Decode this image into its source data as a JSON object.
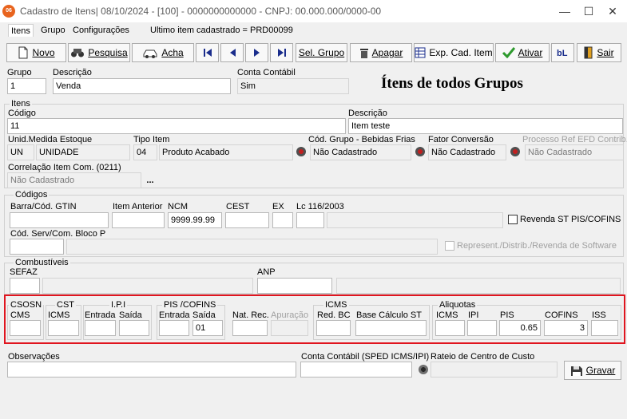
{
  "window": {
    "title": "Cadastro de Itens|  08/10/2024 - [100] - 0000000000000 - CNPJ: 00.000.000/0000-00",
    "app_icon_text": "06",
    "minimize": "—",
    "maximize": "☐",
    "close": "✕"
  },
  "menu": {
    "items": [
      "Itens",
      "Grupo",
      "Configurações"
    ],
    "last_item_info": "Ultimo item cadastrado = PRD00099"
  },
  "toolbar": {
    "novo": "Novo",
    "pesquisa": "Pesquisa",
    "acha": "Acha",
    "sel_grupo": "Sel. Grupo",
    "apagar": "Apagar",
    "exp_cad": "Exp. Cad. Item",
    "ativar": "Ativar",
    "sair": "Sair"
  },
  "header": {
    "grupo_label": "Grupo",
    "grupo_value": "1",
    "descricao_label": "Descrição",
    "descricao_value": "Venda",
    "conta_contabil_label": "Conta Contábil",
    "conta_contabil_value": "Sim",
    "big_title": "Ítens de todos Grupos"
  },
  "itens": {
    "group_title": "Itens",
    "codigo_label": "Código",
    "codigo_value": "11",
    "descricao_label": "Descrição",
    "descricao_value": "Item teste",
    "unid_label": "Unid.Medida Estoque",
    "unid_code": "UN",
    "unid_desc": "UNIDADE",
    "tipo_label": "Tipo Item",
    "tipo_code": "04",
    "tipo_desc": "Produto Acabado",
    "cod_grupo_label": "Cód. Grupo - Bebidas Frias",
    "cod_grupo_value": "Não Cadastrado",
    "fator_label": "Fator Conversão",
    "fator_value": "Não Cadastrado",
    "processo_label": "Processo Ref EFD Contrib.",
    "processo_value": "Não Cadastrado",
    "correlacao_label": "Correlação Item Com. (0211)",
    "correlacao_value": "Não Cadastrado",
    "correlacao_btn": "..."
  },
  "codigos": {
    "group_title": "Códigos",
    "barra_label": "Barra/Cód. GTIN",
    "barra_value": "",
    "anterior_label": "Item Anterior",
    "anterior_value": "",
    "ncm_label": "NCM",
    "ncm_value": "9999.99.99",
    "cest_label": "CEST",
    "cest_value": "",
    "ex_label": "EX",
    "ex_value": "",
    "lc_label": "Lc 116/2003",
    "lc_value": "",
    "revenda_label": "Revenda ST PIS/COFINS",
    "serv_label": "Cód. Serv/Com. Bloco P",
    "serv_value": "",
    "represent_label": "Represent./Distrib./Revenda de Software"
  },
  "combustiveis": {
    "group_title": "Combustíveis",
    "sefaz_label": "SEFAZ",
    "sefaz_value": "",
    "anp_label": "ANP",
    "anp_value": ""
  },
  "tributos": {
    "csosn_label": "CSOSN",
    "cms_label": "CMS",
    "cst_label": "CST",
    "cst_icms_label": "ICMS",
    "ipi_label": "I.P.I",
    "ipi_entrada_label": "Entrada",
    "ipi_saida_label": "Saída",
    "pis_cofins_label": "PIS /COFINS",
    "pc_entrada_label": "Entrada",
    "pc_saida_label": "Saída",
    "pc_saida_value": "01",
    "nat_rec_label": "Nat. Rec.",
    "apuracao_label": "Apuração",
    "icms_group_label": "ICMS",
    "red_bc_label": "Red. BC",
    "base_st_label": "Base Cálculo ST",
    "aliquotas_label": "Aliquotas",
    "aliq_icms_label": "ICMS",
    "aliq_ipi_label": "IPI",
    "aliq_pis_label": "PIS",
    "aliq_pis_value": "0.65",
    "aliq_cofins_label": "COFINS",
    "aliq_cofins_value": "3",
    "aliq_iss_label": "ISS"
  },
  "footer": {
    "obs_label": "Observações",
    "obs_value": "",
    "conta_sped_label": "Conta Contábil (SPED ICMS/IPI)",
    "conta_sped_value": "",
    "rateio_label": "Rateio de Centro de Custo",
    "rateio_value": "",
    "gravar": "Gravar"
  },
  "colors": {
    "highlight": "#e0151f",
    "app_icon": "#e8641e"
  },
  "icons": [
    "new-document-icon",
    "search-binoculars-icon",
    "car-find-icon",
    "first-record-icon",
    "prev-record-icon",
    "next-record-icon",
    "last-record-icon",
    "trash-icon",
    "export-grid-icon",
    "checkmark-icon",
    "bl-icon",
    "exit-door-icon",
    "save-disk-icon"
  ]
}
